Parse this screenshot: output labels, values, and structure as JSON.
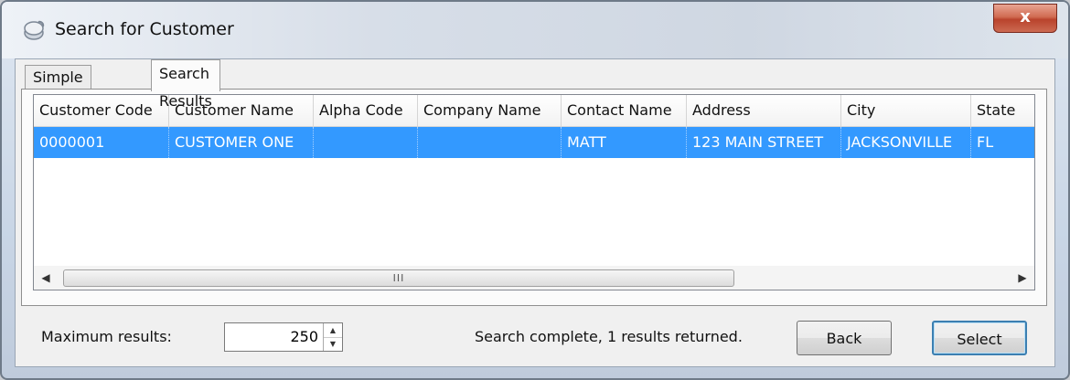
{
  "window": {
    "title": "Search for Customer",
    "close_label": "x"
  },
  "tabs": [
    {
      "label": "Simple Search"
    },
    {
      "label": "Search Results"
    }
  ],
  "grid": {
    "columns": [
      "Customer Code",
      "Customer Name",
      "Alpha Code",
      "Company Name",
      "Contact Name",
      "Address",
      "City",
      "State"
    ],
    "rows": [
      [
        "0000001",
        "CUSTOMER ONE",
        "",
        "",
        "MATT",
        "123 MAIN STREET",
        "JACKSONVILLE",
        "FL"
      ]
    ],
    "scroll_thumb_grip": "III"
  },
  "footer": {
    "max_results_label": "Maximum results:",
    "max_results_value": "250",
    "status": "Search complete, 1 results returned.",
    "back_label": "Back",
    "select_label": "Select"
  },
  "colors": {
    "selection": "#3399ff",
    "close_button": "#c75a42"
  },
  "icons": [
    "app-icon",
    "close-icon",
    "scroll-left-icon",
    "scroll-right-icon",
    "spin-up-icon",
    "spin-down-icon"
  ]
}
